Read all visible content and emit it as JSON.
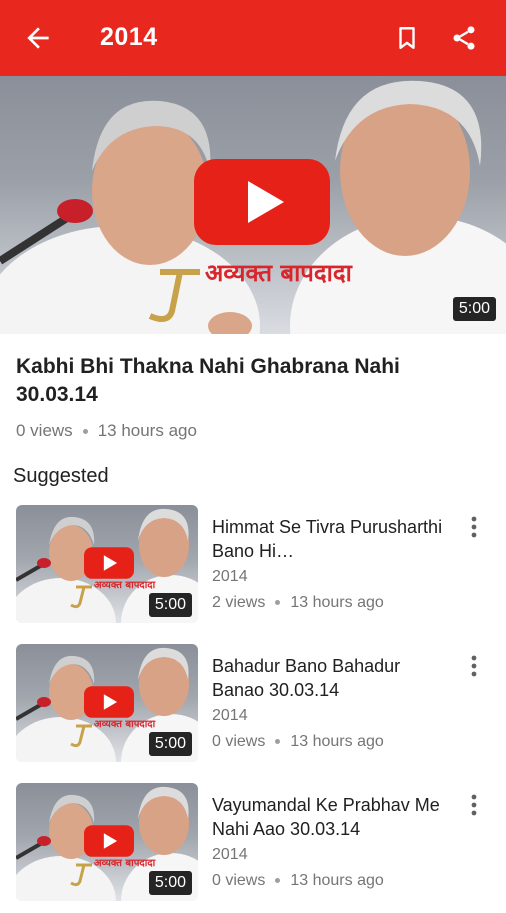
{
  "appbar": {
    "title": "2014",
    "icons": [
      "arrow-back-icon",
      "bookmark-icon",
      "share-icon"
    ],
    "color": "#e8281f"
  },
  "video": {
    "thumbnail_caption": "अव्यक्त बापदादा",
    "duration": "5:00",
    "title": "Kabhi Bhi Thakna Nahi Ghabrana Nahi 30.03.14",
    "views": "0 views",
    "time": "13 hours ago"
  },
  "suggested": {
    "heading": "Suggested",
    "items": [
      {
        "title": "Himmat Se Tivra Purusharthi Bano Hi…",
        "channel": "2014",
        "views": "2 views",
        "time": "13 hours ago",
        "duration": "5:00",
        "thumb_caption": "अव्यक्त बापदादा"
      },
      {
        "title": "Bahadur Bano Bahadur Banao 30.03.14",
        "channel": "2014",
        "views": "0 views",
        "time": "13 hours ago",
        "duration": "5:00",
        "thumb_caption": "अव्यक्त बापदादा"
      },
      {
        "title": "Vayumandal Ke Prabhav Me Nahi Aao 30.03.14",
        "channel": "2014",
        "views": "0 views",
        "time": "13 hours ago",
        "duration": "5:00",
        "thumb_caption": "अव्यक्त बापदादा"
      }
    ]
  },
  "colors": {
    "play_red": "#e62117",
    "caption_red": "#d8262c"
  }
}
